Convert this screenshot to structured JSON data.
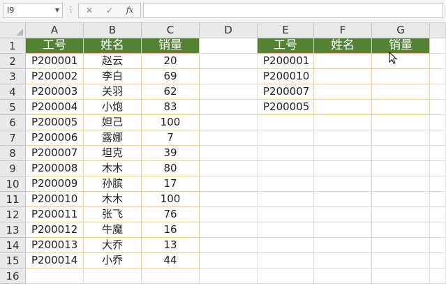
{
  "namebox": {
    "value": "I9"
  },
  "formula": {
    "fx_label": "fx",
    "value": ""
  },
  "columns": [
    "A",
    "B",
    "C",
    "D",
    "E",
    "F",
    "G"
  ],
  "rows": [
    "1",
    "2",
    "3",
    "4",
    "5",
    "6",
    "7",
    "8",
    "9",
    "10",
    "11",
    "12",
    "13",
    "14",
    "15",
    "16"
  ],
  "left_table": {
    "headers": [
      "工号",
      "姓名",
      "销量"
    ],
    "rows": [
      [
        "P200001",
        "赵云",
        "20"
      ],
      [
        "P200002",
        "李白",
        "69"
      ],
      [
        "P200003",
        "关羽",
        "62"
      ],
      [
        "P200004",
        "小炮",
        "83"
      ],
      [
        "P200005",
        "妲己",
        "100"
      ],
      [
        "P200006",
        "露娜",
        "7"
      ],
      [
        "P200007",
        "坦克",
        "39"
      ],
      [
        "P200008",
        "木木",
        "80"
      ],
      [
        "P200009",
        "孙膑",
        "17"
      ],
      [
        "P200010",
        "木木",
        "100"
      ],
      [
        "P200011",
        "张飞",
        "76"
      ],
      [
        "P200012",
        "牛魔",
        "16"
      ],
      [
        "P200013",
        "大乔",
        "13"
      ],
      [
        "P200014",
        "小乔",
        "44"
      ]
    ]
  },
  "right_table": {
    "headers": [
      "工号",
      "姓名",
      "销量"
    ],
    "ids": [
      "P200001",
      "P200010",
      "P200007",
      "P200005"
    ]
  },
  "colors": {
    "header_fill": "#548235",
    "header_text": "#ffffff",
    "table_border": "#f5d08f"
  }
}
